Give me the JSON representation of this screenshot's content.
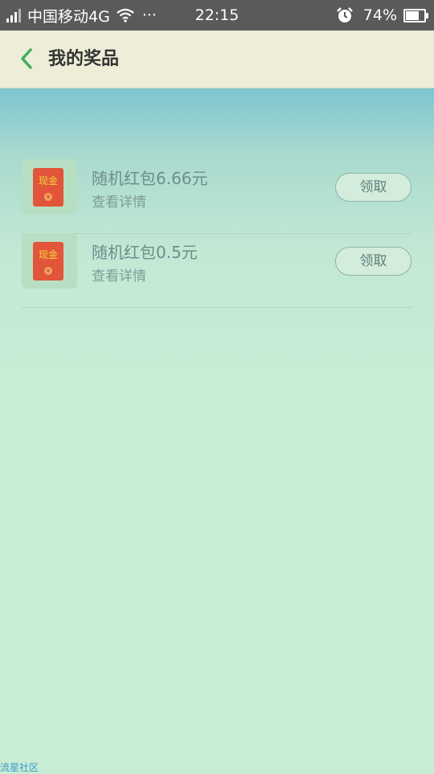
{
  "status_bar": {
    "carrier": "中国移动4G",
    "more": "···",
    "time": "22:15",
    "battery_percent": "74%",
    "battery_level": 0.74,
    "icons": [
      "signal-icon",
      "wifi-icon",
      "alarm-icon",
      "battery-icon"
    ]
  },
  "header": {
    "title": "我的奖品",
    "back_icon": "chevron-left-icon",
    "accent_color": "#3fae5b"
  },
  "prizes": [
    {
      "icon_label": "现金",
      "coin_symbol": "¥",
      "name": "随机红包6.66元",
      "detail": "查看详情",
      "action": "领取"
    },
    {
      "icon_label": "现金",
      "coin_symbol": "¥",
      "name": "随机红包0.5元",
      "detail": "查看详情",
      "action": "领取"
    }
  ],
  "watermark": "流星社区"
}
